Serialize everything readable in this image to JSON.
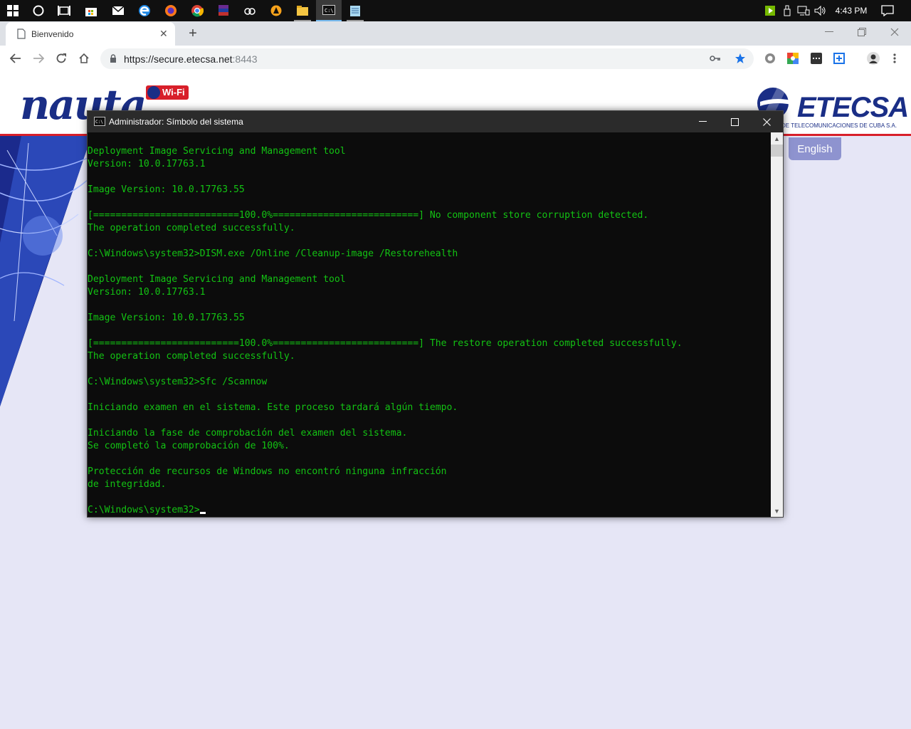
{
  "taskbar": {
    "start_icon": "windows-logo-icon",
    "clock": "4:43 PM",
    "apps": [
      "cortana-icon",
      "task-view-icon",
      "store-icon",
      "mail-icon",
      "edge-icon",
      "firefox-icon",
      "chrome-icon",
      "winrar-icon",
      "app-icon",
      "avast-icon",
      "file-explorer-icon",
      "cmd-icon",
      "notepad-icon"
    ]
  },
  "browser": {
    "tab_title": "Bienvenido",
    "url_host": "https://secure.etecsa.net",
    "url_port": ":8443"
  },
  "page": {
    "nauta_logo": "nauta",
    "wifi_badge": "Wi-Fi",
    "etecsa_logo": "ETECSA",
    "etecsa_sub": "DE TELECOMUNICACIONES DE  CUBA S.A.",
    "language_button": "English"
  },
  "cmd": {
    "title": "Administrador: Símbolo del sistema",
    "lines": [
      "Deployment Image Servicing and Management tool",
      "Version: 10.0.17763.1",
      "",
      "Image Version: 10.0.17763.55",
      "",
      "[==========================100.0%==========================] No component store corruption detected.",
      "The operation completed successfully.",
      "",
      "C:\\Windows\\system32>DISM.exe /Online /Cleanup-image /Restorehealth",
      "",
      "Deployment Image Servicing and Management tool",
      "Version: 10.0.17763.1",
      "",
      "Image Version: 10.0.17763.55",
      "",
      "[==========================100.0%==========================] The restore operation completed successfully.",
      "The operation completed successfully.",
      "",
      "C:\\Windows\\system32>Sfc /Scannow",
      "",
      "Iniciando examen en el sistema. Este proceso tardará algún tiempo.",
      "",
      "Iniciando la fase de comprobación del examen del sistema.",
      "Se completó la comprobación de 100%.",
      "",
      "Protección de recursos de Windows no encontró ninguna infracción",
      "de integridad.",
      "",
      "C:\\Windows\\system32>"
    ]
  },
  "colors": {
    "console_text": "#13c313",
    "console_bg": "#0c0c0c",
    "brand_blue": "#1a2e86",
    "brand_red": "#d81f2a",
    "page_bg": "#e6e6f6"
  }
}
